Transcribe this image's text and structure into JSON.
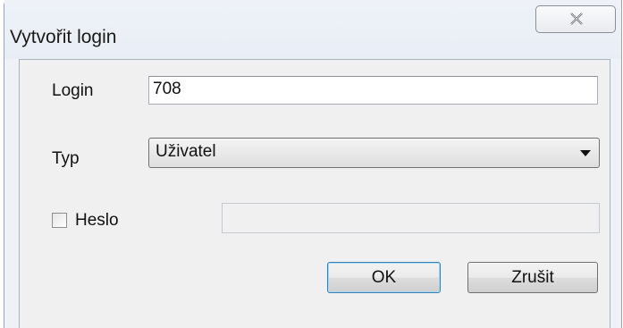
{
  "window": {
    "title": "Vytvořit login",
    "close_glyph": "☒"
  },
  "form": {
    "login_label": "Login",
    "login_value": "708",
    "typ_label": "Typ",
    "typ_selected": "Uživatel",
    "heslo_label": "Heslo",
    "heslo_checked": false,
    "heslo_value": ""
  },
  "buttons": {
    "ok_label": "OK",
    "cancel_label": "Zrušit"
  },
  "icons": {
    "close": "close-icon",
    "dropdown": "chevron-down-icon"
  }
}
